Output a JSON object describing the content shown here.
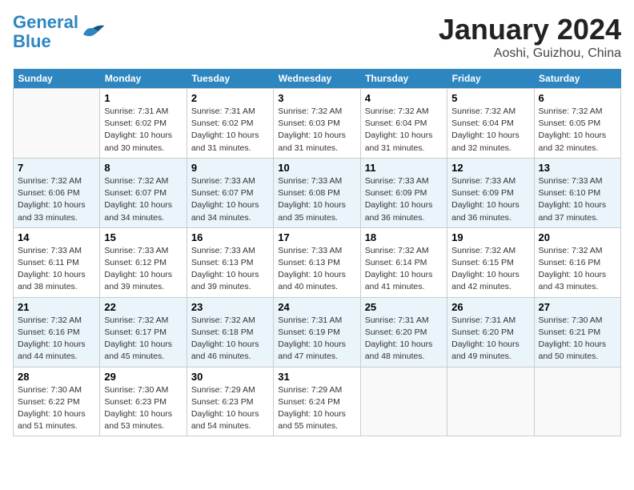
{
  "header": {
    "logo_line1": "General",
    "logo_line2": "Blue",
    "month": "January 2024",
    "location": "Aoshi, Guizhou, China"
  },
  "days_of_week": [
    "Sunday",
    "Monday",
    "Tuesday",
    "Wednesday",
    "Thursday",
    "Friday",
    "Saturday"
  ],
  "weeks": [
    [
      {
        "day": "",
        "sunrise": "",
        "sunset": "",
        "daylight": ""
      },
      {
        "day": "1",
        "sunrise": "7:31 AM",
        "sunset": "6:02 PM",
        "daylight": "10 hours and 30 minutes."
      },
      {
        "day": "2",
        "sunrise": "7:31 AM",
        "sunset": "6:02 PM",
        "daylight": "10 hours and 31 minutes."
      },
      {
        "day": "3",
        "sunrise": "7:32 AM",
        "sunset": "6:03 PM",
        "daylight": "10 hours and 31 minutes."
      },
      {
        "day": "4",
        "sunrise": "7:32 AM",
        "sunset": "6:04 PM",
        "daylight": "10 hours and 31 minutes."
      },
      {
        "day": "5",
        "sunrise": "7:32 AM",
        "sunset": "6:04 PM",
        "daylight": "10 hours and 32 minutes."
      },
      {
        "day": "6",
        "sunrise": "7:32 AM",
        "sunset": "6:05 PM",
        "daylight": "10 hours and 32 minutes."
      }
    ],
    [
      {
        "day": "7",
        "sunrise": "7:32 AM",
        "sunset": "6:06 PM",
        "daylight": "10 hours and 33 minutes."
      },
      {
        "day": "8",
        "sunrise": "7:32 AM",
        "sunset": "6:07 PM",
        "daylight": "10 hours and 34 minutes."
      },
      {
        "day": "9",
        "sunrise": "7:33 AM",
        "sunset": "6:07 PM",
        "daylight": "10 hours and 34 minutes."
      },
      {
        "day": "10",
        "sunrise": "7:33 AM",
        "sunset": "6:08 PM",
        "daylight": "10 hours and 35 minutes."
      },
      {
        "day": "11",
        "sunrise": "7:33 AM",
        "sunset": "6:09 PM",
        "daylight": "10 hours and 36 minutes."
      },
      {
        "day": "12",
        "sunrise": "7:33 AM",
        "sunset": "6:09 PM",
        "daylight": "10 hours and 36 minutes."
      },
      {
        "day": "13",
        "sunrise": "7:33 AM",
        "sunset": "6:10 PM",
        "daylight": "10 hours and 37 minutes."
      }
    ],
    [
      {
        "day": "14",
        "sunrise": "7:33 AM",
        "sunset": "6:11 PM",
        "daylight": "10 hours and 38 minutes."
      },
      {
        "day": "15",
        "sunrise": "7:33 AM",
        "sunset": "6:12 PM",
        "daylight": "10 hours and 39 minutes."
      },
      {
        "day": "16",
        "sunrise": "7:33 AM",
        "sunset": "6:13 PM",
        "daylight": "10 hours and 39 minutes."
      },
      {
        "day": "17",
        "sunrise": "7:33 AM",
        "sunset": "6:13 PM",
        "daylight": "10 hours and 40 minutes."
      },
      {
        "day": "18",
        "sunrise": "7:32 AM",
        "sunset": "6:14 PM",
        "daylight": "10 hours and 41 minutes."
      },
      {
        "day": "19",
        "sunrise": "7:32 AM",
        "sunset": "6:15 PM",
        "daylight": "10 hours and 42 minutes."
      },
      {
        "day": "20",
        "sunrise": "7:32 AM",
        "sunset": "6:16 PM",
        "daylight": "10 hours and 43 minutes."
      }
    ],
    [
      {
        "day": "21",
        "sunrise": "7:32 AM",
        "sunset": "6:16 PM",
        "daylight": "10 hours and 44 minutes."
      },
      {
        "day": "22",
        "sunrise": "7:32 AM",
        "sunset": "6:17 PM",
        "daylight": "10 hours and 45 minutes."
      },
      {
        "day": "23",
        "sunrise": "7:32 AM",
        "sunset": "6:18 PM",
        "daylight": "10 hours and 46 minutes."
      },
      {
        "day": "24",
        "sunrise": "7:31 AM",
        "sunset": "6:19 PM",
        "daylight": "10 hours and 47 minutes."
      },
      {
        "day": "25",
        "sunrise": "7:31 AM",
        "sunset": "6:20 PM",
        "daylight": "10 hours and 48 minutes."
      },
      {
        "day": "26",
        "sunrise": "7:31 AM",
        "sunset": "6:20 PM",
        "daylight": "10 hours and 49 minutes."
      },
      {
        "day": "27",
        "sunrise": "7:30 AM",
        "sunset": "6:21 PM",
        "daylight": "10 hours and 50 minutes."
      }
    ],
    [
      {
        "day": "28",
        "sunrise": "7:30 AM",
        "sunset": "6:22 PM",
        "daylight": "10 hours and 51 minutes."
      },
      {
        "day": "29",
        "sunrise": "7:30 AM",
        "sunset": "6:23 PM",
        "daylight": "10 hours and 53 minutes."
      },
      {
        "day": "30",
        "sunrise": "7:29 AM",
        "sunset": "6:23 PM",
        "daylight": "10 hours and 54 minutes."
      },
      {
        "day": "31",
        "sunrise": "7:29 AM",
        "sunset": "6:24 PM",
        "daylight": "10 hours and 55 minutes."
      },
      {
        "day": "",
        "sunrise": "",
        "sunset": "",
        "daylight": ""
      },
      {
        "day": "",
        "sunrise": "",
        "sunset": "",
        "daylight": ""
      },
      {
        "day": "",
        "sunrise": "",
        "sunset": "",
        "daylight": ""
      }
    ]
  ],
  "labels": {
    "sunrise_prefix": "Sunrise: ",
    "sunset_prefix": "Sunset: ",
    "daylight_prefix": "Daylight: "
  }
}
